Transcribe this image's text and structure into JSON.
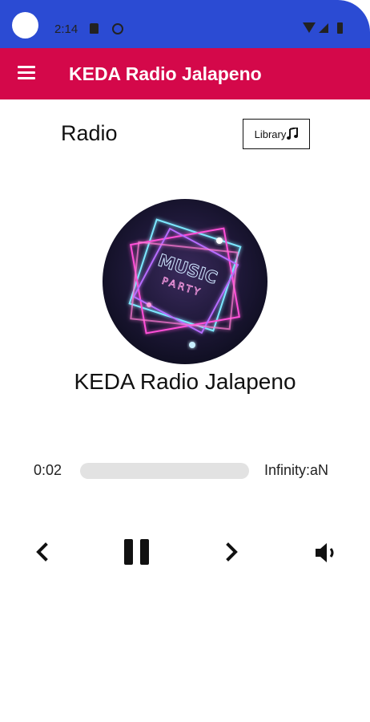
{
  "status": {
    "time": "2:14"
  },
  "appbar": {
    "title": "KEDA Radio Jalapeno",
    "menu_icon": "hamburger-menu-icon"
  },
  "header": {
    "section_title": "Radio",
    "library_button": "Library",
    "library_icon": "music-note-icon"
  },
  "player": {
    "art_text_line1": "MUSIC",
    "art_text_line2": "PARTY",
    "station_name": "KEDA Radio Jalapeno",
    "time_current": "0:02",
    "time_total": "Infinity:aN",
    "progress": 0.0,
    "controls": [
      "previous-icon",
      "pause-icon",
      "next-icon",
      "volume-icon"
    ]
  },
  "colors": {
    "status_bar": "#2b4bd3",
    "app_bar": "#d4084a",
    "progress_track": "#e2e2e2"
  }
}
